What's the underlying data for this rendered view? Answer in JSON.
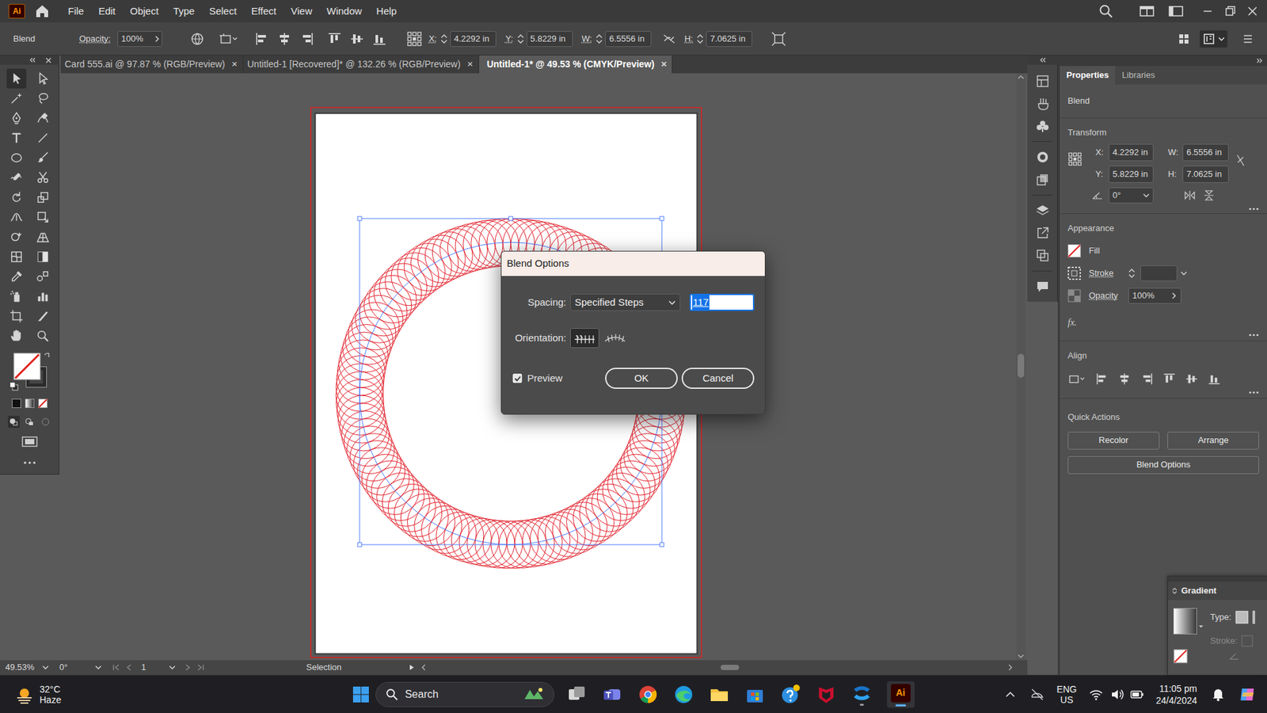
{
  "app": {
    "logo": "Ai"
  },
  "menu": [
    "File",
    "Edit",
    "Object",
    "Type",
    "Select",
    "Effect",
    "View",
    "Window",
    "Help"
  ],
  "control_bar": {
    "object": "Blend",
    "opacity_label": "Opacity:",
    "opacity": "100%",
    "x_label": "X:",
    "x": "4.2292 in",
    "y_label": "Y:",
    "y": "5.8229 in",
    "w_label": "W:",
    "w": "6.5556 in",
    "h_label": "H:",
    "h": "7.0625 in"
  },
  "tabs": [
    {
      "label": "Card 555.ai @ 97.87 % (RGB/Preview)",
      "selected": false
    },
    {
      "label": "Untitled-1 [Recovered]* @ 132.26 % (RGB/Preview)",
      "selected": false
    },
    {
      "label": "Untitled-1* @ 49.53 % (CMYK/Preview)",
      "selected": true
    }
  ],
  "tab_close": "×",
  "dialog": {
    "title": "Blend Options",
    "spacing_label": "Spacing:",
    "spacing": "Specified Steps",
    "steps": "117",
    "orientation_label": "Orientation:",
    "orientation": [
      {
        "kind": "page",
        "selected": true
      },
      {
        "kind": "path",
        "selected": false
      }
    ],
    "preview": {
      "label": "Preview",
      "checked": true
    },
    "buttons": [
      "OK",
      "Cancel"
    ]
  },
  "status_bar": {
    "zoom": "49.53%",
    "rotation": "0°",
    "artboard": "1",
    "tool": "Selection"
  },
  "panel": {
    "tabs": [
      {
        "label": "Properties",
        "selected": true
      },
      {
        "label": "Libraries",
        "selected": false
      }
    ],
    "object": "Blend",
    "transform": {
      "title": "Transform",
      "x_label": "X:",
      "x": "4.2292 in",
      "y_label": "Y:",
      "y": "5.8229 in",
      "w_label": "W:",
      "w": "6.5556 in",
      "h_label": "H:",
      "h": "7.0625 in",
      "angle": "0°"
    },
    "appearance": {
      "title": "Appearance",
      "fill": "Fill",
      "stroke": "Stroke",
      "opacity_label": "Opacity",
      "opacity": "100%",
      "fx": "fx."
    },
    "align": {
      "title": "Align"
    },
    "quick_actions": {
      "title": "Quick Actions",
      "buttons": [
        "Recolor",
        "Arrange",
        "Blend Options"
      ]
    }
  },
  "gradient_panel": {
    "title": "Gradient",
    "type_label": "Type:",
    "stroke_label": "Stroke:"
  },
  "taskbar": {
    "temperature": "32°C",
    "weather": "Haze",
    "search": "Search",
    "language": "ENG",
    "region": "US",
    "time": "11:05 pm",
    "date": "24/4/2024"
  }
}
